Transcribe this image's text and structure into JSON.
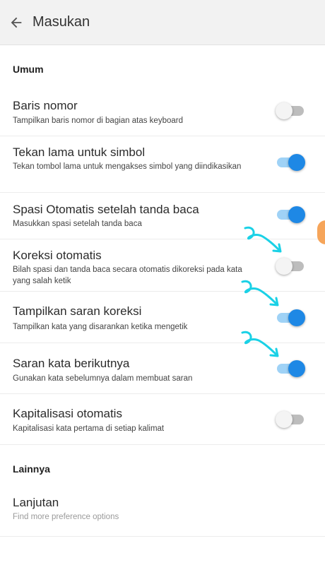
{
  "appbar": {
    "title": "Masukan",
    "back_icon": "arrow-left-icon"
  },
  "sections": [
    {
      "title": "Umum"
    },
    {
      "title": "Lainnya"
    }
  ],
  "settings": [
    {
      "title": "Baris nomor",
      "subtitle": "Tampilkan baris nomor di bagian atas keyboard",
      "enabled": false
    },
    {
      "title": "Tekan lama untuk simbol",
      "subtitle": "Tekan tombol lama untuk mengakses simbol yang diindikasikan",
      "enabled": true
    },
    {
      "title": "Spasi Otomatis setelah tanda baca",
      "subtitle": "Masukkan spasi setelah tanda baca",
      "enabled": true
    },
    {
      "title": "Koreksi otomatis",
      "subtitle": "Bilah spasi dan tanda baca secara otomatis dikoreksi pada kata yang salah ketik",
      "enabled": false
    },
    {
      "title": "Tampilkan saran koreksi",
      "subtitle": "Tampilkan kata yang disarankan ketika mengetik",
      "enabled": true
    },
    {
      "title": "Saran kata berikutnya",
      "subtitle": "Gunakan kata sebelumnya dalam membuat saran",
      "enabled": true
    },
    {
      "title": "Kapitalisasi otomatis",
      "subtitle": "Kapitalisasi kata pertama di setiap kalimat",
      "enabled": false
    }
  ],
  "advanced": {
    "title": "Lanjutan",
    "subtitle": "Find more preference options"
  },
  "colors": {
    "accent": "#1e88e5",
    "accent_track": "#9fd2f6",
    "annotation": "#1ad1e6"
  }
}
